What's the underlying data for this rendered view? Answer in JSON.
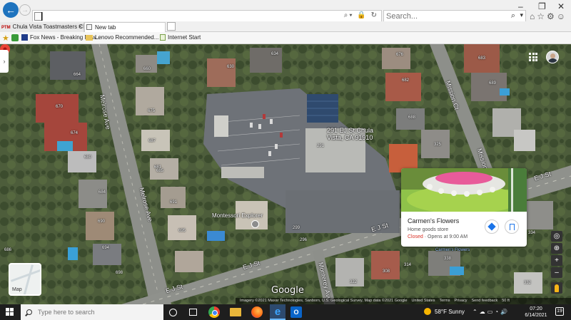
{
  "browser": {
    "address_value": "",
    "search_placeholder": "Search...",
    "window_controls": {
      "minimize": "–",
      "maximize": "❐",
      "close": "✕"
    },
    "toolbar_icons": [
      "home-icon",
      "favorites-star-icon",
      "settings-gear-icon",
      "smiley-icon"
    ]
  },
  "tabs": [
    {
      "label": "Chula Vista Toastmasters Club ...",
      "favicon": "PTM",
      "active": false
    },
    {
      "label": "New tab",
      "active": true
    }
  ],
  "favorites": [
    {
      "label": "Fox News - Breaking New...",
      "icon": "fox-news-icon"
    },
    {
      "label": "Lenovo Recommended...",
      "icon": "folder-icon"
    },
    {
      "label": "Internet Start",
      "icon": "page-icon"
    }
  ],
  "map": {
    "place": {
      "address_line1": "291 EJ St Chula",
      "address_line2": "Vista, CA 91910",
      "number": "291"
    },
    "streets": {
      "melrose_upper": "Melrose Ave",
      "melrose_lower": "Melrose Ave",
      "mission": "Mission Ct",
      "ej_1": "E J St",
      "ej_2": "E J St",
      "ej_3": "E J St",
      "ej_4": "E J St",
      "monterey": "Monterey Ave",
      "mission_lower": "Mission"
    },
    "house_numbers": [
      "664",
      "660",
      "630",
      "634",
      "676",
      "683",
      "689",
      "682",
      "670",
      "674",
      "675",
      "687",
      "680",
      "681",
      "685",
      "684",
      "691",
      "690",
      "694",
      "695",
      "698",
      "686",
      "688",
      "325",
      "334",
      "338",
      "299",
      "296",
      "314",
      "308",
      "322",
      "332"
    ],
    "poi": "Montessori Explorer",
    "poi_small": "Carmen's Flowers",
    "google_logo": "Google",
    "attribution": [
      "Imagery ©2021 Maxar Technologies, Sanborn, U.S. Geological Survey, Map data ©2021 Google",
      "United States",
      "Terms",
      "Privacy",
      "Send feedback",
      "50 ft"
    ],
    "thumbnail_label": "Map",
    "controls": {
      "zoom_in": "+",
      "zoom_out": "–"
    },
    "side_toggle": "›"
  },
  "card": {
    "name": "Carmen's Flowers",
    "category": "Home goods store",
    "status": "Closed",
    "opens": "· Opens at 9:00 AM"
  },
  "taskbar": {
    "search_placeholder": "Type here to search",
    "weather": "58°F  Sunny",
    "time": "07:20",
    "date": "6/14/2021",
    "notifications": "19",
    "edge_letter": "e",
    "outlook_letter": "O"
  },
  "colors": {
    "accent": "#1e73be",
    "closed": "#d93025",
    "link": "#1a73e8"
  }
}
